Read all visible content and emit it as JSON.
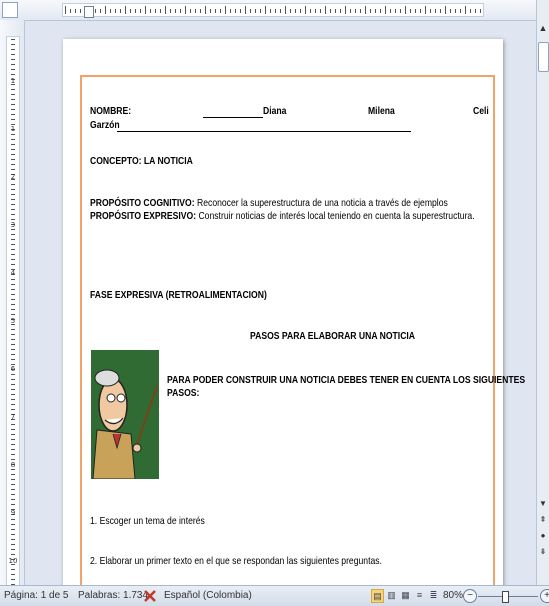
{
  "document": {
    "nombre_label": "NOMBRE:",
    "nombre_fill": "Diana",
    "name2": "Milena",
    "name3": "Celi",
    "surname": "Garzón",
    "concepto": "CONCEPTO: LA NOTICIA",
    "proposito_cog_label": "PROPÓSITO COGNITIVO:",
    "proposito_cog_text": "Reconocer la superestructura de una noticia a través de ejemplos",
    "proposito_exp_label": "PROPÓSITO EXPRESIVO:",
    "proposito_exp_text": "Construir noticias de interés local teniendo en cuenta la superestructura.",
    "fase": "FASE EXPRESIVA (RETROALIMENTACION)",
    "pasos_title": "PASOS PARA ELABORAR UNA NOTICIA",
    "pasos_intro_1": "PARA PODER CONSTRUIR UNA NOTICIA DEBES TENER EN CUENTA LOS SIGUIENTES",
    "pasos_intro_2": "PASOS:",
    "step1": "1. Escoger un tema de interés",
    "step2": "2. Elaborar un primer texto en el que se respondan las siguientes preguntas."
  },
  "status": {
    "page": "Página: 1 de 5",
    "words": "Palabras: 1.734",
    "language": "Español (Colombia)",
    "zoom": "80%"
  },
  "ruler": {
    "left_numbers": [
      "1",
      "1",
      "2",
      "3",
      "4",
      "5",
      "6",
      "7",
      "8",
      "9",
      "10"
    ]
  },
  "colors": {
    "page_border": "#f1a36c",
    "illustration_bg": "#2f6b32"
  }
}
